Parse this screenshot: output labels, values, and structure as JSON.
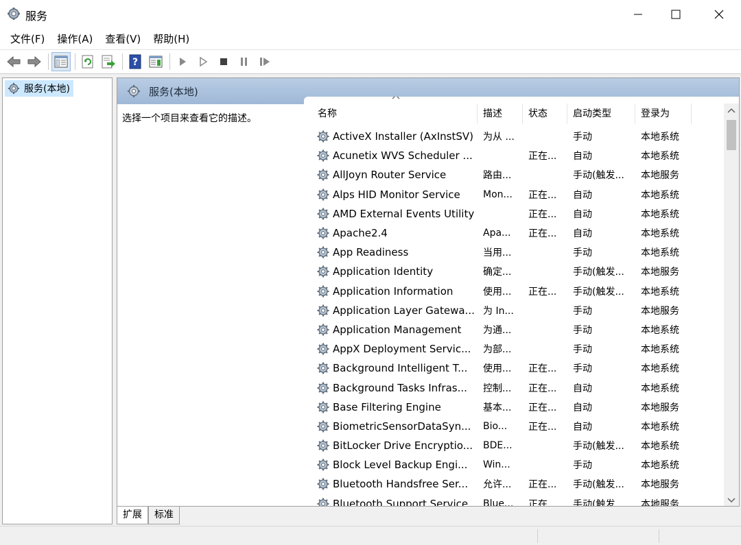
{
  "window": {
    "title": "服务",
    "icon": "services-gear-icon"
  },
  "menu": [
    {
      "label": "文件(F)"
    },
    {
      "label": "操作(A)"
    },
    {
      "label": "查看(V)"
    },
    {
      "label": "帮助(H)"
    }
  ],
  "toolbar": [
    "back-arrow-icon",
    "forward-arrow-icon",
    "sep",
    "show-hide-console-tree-icon",
    "sep",
    "refresh-icon",
    "export-list-icon",
    "sep",
    "help-icon",
    "properties-pane-icon",
    "sep",
    "start-service-icon",
    "start-service-alt-icon",
    "stop-service-icon",
    "pause-service-icon",
    "resume-service-icon"
  ],
  "tree": {
    "item_label": "服务(本地)"
  },
  "pane": {
    "header_title": "服务(本地)",
    "description_prompt": "选择一个项目来查看它的描述。"
  },
  "columns": {
    "name": "名称",
    "desc": "描述",
    "status": "状态",
    "startup": "启动类型",
    "logon": "登录为"
  },
  "services": [
    {
      "name": "ActiveX Installer (AxInstSV)",
      "desc": "为从 ...",
      "status": "",
      "startup": "手动",
      "logon": "本地系统"
    },
    {
      "name": "Acunetix WVS Scheduler ...",
      "desc": "",
      "status": "正在...",
      "startup": "自动",
      "logon": "本地系统"
    },
    {
      "name": "AllJoyn Router Service",
      "desc": "路由...",
      "status": "",
      "startup": "手动(触发...",
      "logon": "本地服务"
    },
    {
      "name": "Alps HID Monitor Service",
      "desc": "Mon...",
      "status": "正在...",
      "startup": "自动",
      "logon": "本地系统"
    },
    {
      "name": "AMD External Events Utility",
      "desc": "",
      "status": "正在...",
      "startup": "自动",
      "logon": "本地系统"
    },
    {
      "name": "Apache2.4",
      "desc": "Apa...",
      "status": "正在...",
      "startup": "自动",
      "logon": "本地系统"
    },
    {
      "name": "App Readiness",
      "desc": "当用...",
      "status": "",
      "startup": "手动",
      "logon": "本地系统"
    },
    {
      "name": "Application Identity",
      "desc": "确定...",
      "status": "",
      "startup": "手动(触发...",
      "logon": "本地服务"
    },
    {
      "name": "Application Information",
      "desc": "使用...",
      "status": "正在...",
      "startup": "手动(触发...",
      "logon": "本地系统"
    },
    {
      "name": "Application Layer Gatewa...",
      "desc": "为 In...",
      "status": "",
      "startup": "手动",
      "logon": "本地服务"
    },
    {
      "name": "Application Management",
      "desc": "为通...",
      "status": "",
      "startup": "手动",
      "logon": "本地系统"
    },
    {
      "name": "AppX Deployment Servic...",
      "desc": "为部...",
      "status": "",
      "startup": "手动",
      "logon": "本地系统"
    },
    {
      "name": "Background Intelligent T...",
      "desc": "使用...",
      "status": "正在...",
      "startup": "手动",
      "logon": "本地系统"
    },
    {
      "name": "Background Tasks Infras...",
      "desc": "控制...",
      "status": "正在...",
      "startup": "自动",
      "logon": "本地系统"
    },
    {
      "name": "Base Filtering Engine",
      "desc": "基本...",
      "status": "正在...",
      "startup": "自动",
      "logon": "本地服务"
    },
    {
      "name": "BiometricSensorDataSyn...",
      "desc": "Bio...",
      "status": "正在...",
      "startup": "自动",
      "logon": "本地系统"
    },
    {
      "name": "BitLocker Drive Encryptio...",
      "desc": "BDE...",
      "status": "",
      "startup": "手动(触发...",
      "logon": "本地系统"
    },
    {
      "name": "Block Level Backup Engi...",
      "desc": "Win...",
      "status": "",
      "startup": "手动",
      "logon": "本地系统"
    },
    {
      "name": "Bluetooth Handsfree Ser...",
      "desc": "允许...",
      "status": "正在...",
      "startup": "手动(触发...",
      "logon": "本地服务"
    },
    {
      "name": "Bluetooth Support Service",
      "desc": "Blue...",
      "status": "正在...",
      "startup": "手动(触发...",
      "logon": "本地服务"
    }
  ],
  "tabs": [
    {
      "label": "扩展",
      "active": true
    },
    {
      "label": "标准",
      "active": false
    }
  ]
}
